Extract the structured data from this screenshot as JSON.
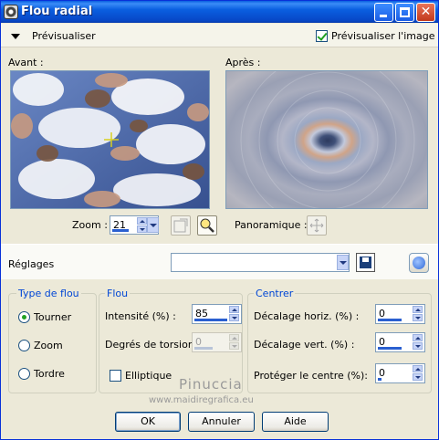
{
  "window": {
    "title": "Flou radial"
  },
  "preview_bar": {
    "label": "Prévisualiser",
    "checkbox_label": "Prévisualiser l'image",
    "checkbox_checked": true
  },
  "panes": {
    "before_label": "Avant :",
    "after_label": "Après :"
  },
  "zoom": {
    "label": "Zoom :",
    "value": "21"
  },
  "panoramique": {
    "label": "Panoramique :"
  },
  "reglages": {
    "label": "Réglages",
    "preset_value": ""
  },
  "type_de_flou": {
    "legend": "Type de flou",
    "options": [
      "Tourner",
      "Zoom",
      "Tordre"
    ],
    "selected": "Tourner"
  },
  "flou": {
    "legend": "Flou",
    "intensite_label": "Intensité (%) :",
    "intensite_value": "85",
    "torsion_label": "Degrés de torsion :",
    "torsion_value": "0",
    "elliptique_label": "Elliptique",
    "elliptique_checked": false
  },
  "centrer": {
    "legend": "Centrer",
    "horiz_label": "Décalage horiz. (%) :",
    "horiz_value": "0",
    "vert_label": "Décalage vert. (%) :",
    "vert_value": "0",
    "protect_label": "Protéger le centre (%):",
    "protect_value": "0"
  },
  "buttons": {
    "ok": "OK",
    "cancel": "Annuler",
    "help": "Aide"
  },
  "watermark": {
    "name": "Pinuccia",
    "url": "www.maidiregrafica.eu"
  },
  "colors": {
    "title_bar": "#0a5fe0",
    "accent": "#0046d5",
    "check_green": "#21a121"
  }
}
